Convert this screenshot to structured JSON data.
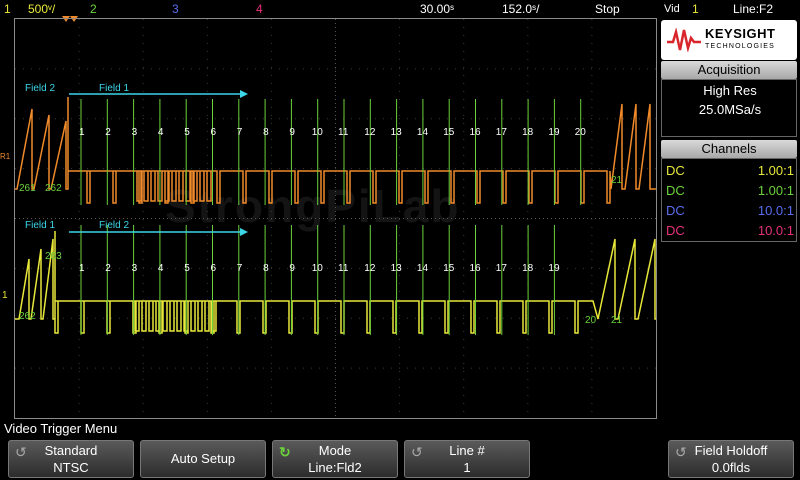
{
  "topbar": {
    "ch1_num": "1",
    "ch1_scale": "500ᵛ/",
    "ch2_num": "2",
    "ch3_num": "3",
    "ch4_num": "4",
    "timebase": "30.00ˢ",
    "delay": "152.0ˢ/",
    "run_state": "Stop",
    "trig_type": "Vid",
    "trig_src": "1",
    "trig_line": "Line:F2"
  },
  "colors": {
    "ch1": "#e8e83a",
    "ch2": "#6bd23b",
    "ch3": "#5a6cf0",
    "ch4": "#e8307a",
    "orange": "#f08a2a",
    "cyan": "#3cd6e8",
    "green_lbl": "#6bd23b"
  },
  "logo": {
    "brand": "KEYSIGHT",
    "sub": "TECHNOLOGIES"
  },
  "acquisition": {
    "title": "Acquisition",
    "mode": "High Res",
    "rate": "25.0MSa/s"
  },
  "channels": {
    "title": "Channels",
    "rows": [
      {
        "coupling": "DC",
        "scale": "1.00:1"
      },
      {
        "coupling": "DC",
        "scale": "1.00:1"
      },
      {
        "coupling": "DC",
        "scale": "10.0:1"
      },
      {
        "coupling": "DC",
        "scale": "10.0:1"
      }
    ]
  },
  "waveform": {
    "watermark": "StrongPiLab",
    "top": {
      "field_a": "Field 2",
      "field_b": "Field 1",
      "left_a": "261",
      "left_b": "262",
      "right": "21",
      "lines": [
        "1",
        "2",
        "3",
        "4",
        "5",
        "6",
        "7",
        "8",
        "9",
        "10",
        "11",
        "12",
        "13",
        "14",
        "15",
        "16",
        "17",
        "18",
        "19",
        "20"
      ]
    },
    "bottom": {
      "field_a": "Field 1",
      "field_b": "Field 2",
      "left_a": "263",
      "left_b": "262",
      "right_a": "20",
      "right_b": "21",
      "lines": [
        "1",
        "2",
        "3",
        "4",
        "5",
        "6",
        "7",
        "8",
        "9",
        "10",
        "11",
        "12",
        "13",
        "14",
        "15",
        "16",
        "17",
        "18",
        "19"
      ]
    },
    "marker_r1": "R1",
    "marker_1": "1"
  },
  "menu": {
    "title": "Video Trigger Menu",
    "standard": {
      "label": "Standard",
      "value": "NTSC"
    },
    "auto_setup": "Auto Setup",
    "mode": {
      "label": "Mode",
      "value": "Line:Fld2"
    },
    "line": {
      "label": "Line #",
      "value": "1"
    },
    "holdoff": {
      "label": "Field Holdoff",
      "value": "0.0flds"
    }
  }
}
